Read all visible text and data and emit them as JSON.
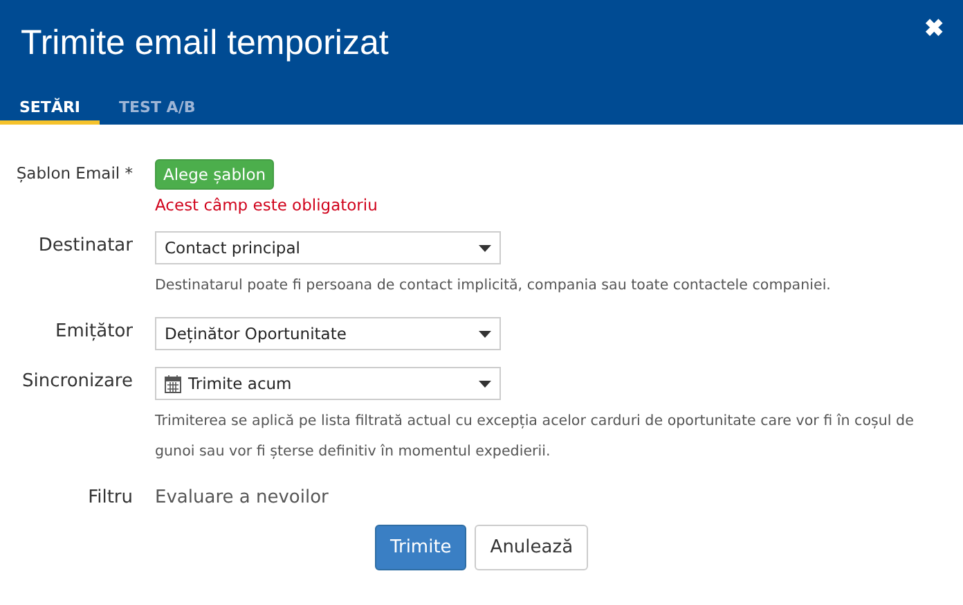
{
  "window": {
    "title": "Trimite email temporizat",
    "close": "✖"
  },
  "tabs": [
    {
      "label": "SETĂRI",
      "selected": true
    },
    {
      "label": "TEST A/B",
      "selected": false
    }
  ],
  "rows": [
    {
      "kind": "template",
      "label": "Șablon Email *",
      "button": "Alege șablon",
      "error": "Acest câmp este obligatoriu"
    },
    {
      "kind": "select",
      "label": "Destinatar",
      "value": "Contact principal",
      "help": "Destinatarul poate fi persoana de contact implicită, compania sau toate contactele companiei."
    },
    {
      "kind": "select",
      "label": "Emițător",
      "value": "Deținător Oportunitate"
    },
    {
      "kind": "date-select",
      "label": "Sincronizare",
      "value": "Trimite acum",
      "help": "Trimiterea se aplică pe lista filtrată actual cu excepția acelor carduri de oportunitate care vor fi în coșul de gunoi sau vor fi șterse definitiv în momentul expedierii."
    },
    {
      "kind": "text",
      "label": "Filtru",
      "value": "Evaluare a nevoilor"
    }
  ],
  "buttons": [
    {
      "label": "Trimite",
      "kind": "primary"
    },
    {
      "label": "Anulează",
      "kind": "default"
    }
  ]
}
